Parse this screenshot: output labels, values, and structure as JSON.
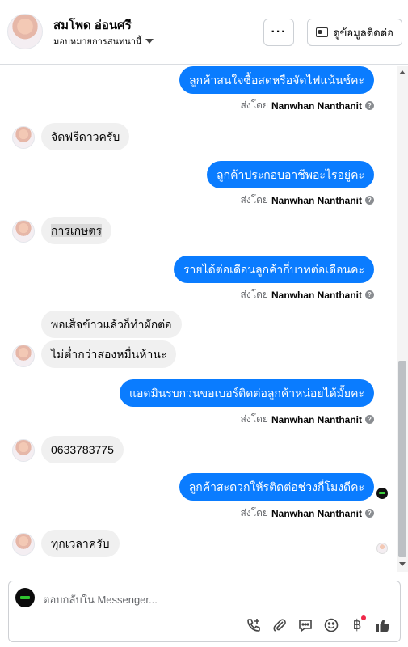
{
  "header": {
    "name": "สมโพด อ่อนศรี",
    "assign_label": "มอบหมายการสนทนานี้",
    "more_label": "···",
    "contact_label": "ดูข้อมูลติดต่อ"
  },
  "messages": [
    {
      "side": "out",
      "text": "ลูกค้าสนใจซื้อสดหรือจัดไฟแน้นช์คะ",
      "sent_prefix": "ส่งโดย",
      "sent_by": "Nanwhan Nanthanit"
    },
    {
      "side": "in",
      "text": "จัดฟรีดาวครับ"
    },
    {
      "side": "out",
      "text": "ลูกค้าประกอบอาชีพอะไรอยู่คะ",
      "sent_prefix": "ส่งโดย",
      "sent_by": "Nanwhan Nanthanit"
    },
    {
      "side": "in",
      "text": "การเกษตร"
    },
    {
      "side": "out",
      "text": "รายได้ต่อเดือนลูกค้ากี่บาทต่อเดือนคะ",
      "sent_prefix": "ส่งโดย",
      "sent_by": "Nanwhan Nanthanit"
    },
    {
      "side": "in",
      "text": "พอเส็จข้าวแล้วก็ทำผักต่อ"
    },
    {
      "side": "in",
      "text": "ไม่ต่ำกว่าสองหมื่นห้านะ"
    },
    {
      "side": "out",
      "text": "แอดมินรบกวนขอเบอร์ติดต่อลูกค้าหน่อยได้มั้ยคะ",
      "sent_prefix": "ส่งโดย",
      "sent_by": "Nanwhan Nanthanit"
    },
    {
      "side": "in",
      "text": "0633783775"
    },
    {
      "side": "out",
      "text": "ลูกค้าสะดวกให้รติดต่อช่วงกี่โมงดีคะ",
      "sent_prefix": "ส่งโดย",
      "sent_by": "Nanwhan Nanthanit"
    },
    {
      "side": "in",
      "text": "ทุกเวลาครับ"
    }
  ],
  "composer": {
    "placeholder": "ตอบกลับใน Messenger...",
    "value": ""
  },
  "icons": [
    "phone-plus-icon",
    "attachment-icon",
    "chat-bubble-icon",
    "emoji-icon",
    "baht-icon",
    "thumbs-up-icon"
  ],
  "colors": {
    "outgoing_bubble": "#0a7cff",
    "incoming_bubble": "#f0f0f0",
    "notification_dot": "#f02849"
  }
}
